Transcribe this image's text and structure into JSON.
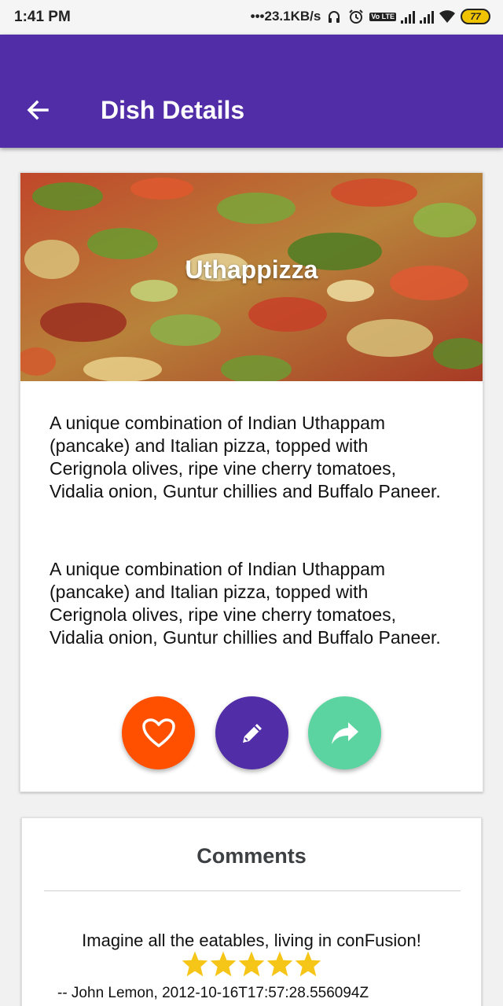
{
  "status_bar": {
    "time": "1:41 PM",
    "network_speed": "•••23.1KB/s",
    "battery_level": "77",
    "lte_label": "Vo LTE"
  },
  "app_bar": {
    "title": "Dish Details",
    "back_icon": "arrow-back-icon",
    "background_color": "#512da8"
  },
  "dish": {
    "name": "Uthappizza",
    "description": "A unique combination of Indian Uthappam (pancake) and Italian pizza, topped with Cerignola olives, ripe vine cherry tomatoes, Vidalia onion, Guntur chillies and Buffalo Paneer.",
    "description_repeat": "A unique combination of Indian Uthappam (pancake) and Italian pizza, topped with Cerignola olives, ripe vine cherry tomatoes, Vidalia onion, Guntur chillies and Buffalo Paneer."
  },
  "actions": {
    "favorite": {
      "icon": "heart-outline-icon",
      "color": "#ff5000"
    },
    "edit": {
      "icon": "pencil-icon",
      "color": "#512da8"
    },
    "share": {
      "icon": "share-arrow-icon",
      "color": "#5bd4a2"
    }
  },
  "comments": {
    "title": "Comments",
    "items": [
      {
        "text": "Imagine all the eatables, living in conFusion!",
        "rating": 5,
        "author_line": "-- John Lemon, 2012-10-16T17:57:28.556094Z"
      }
    ],
    "star_color": "#f5c518"
  }
}
